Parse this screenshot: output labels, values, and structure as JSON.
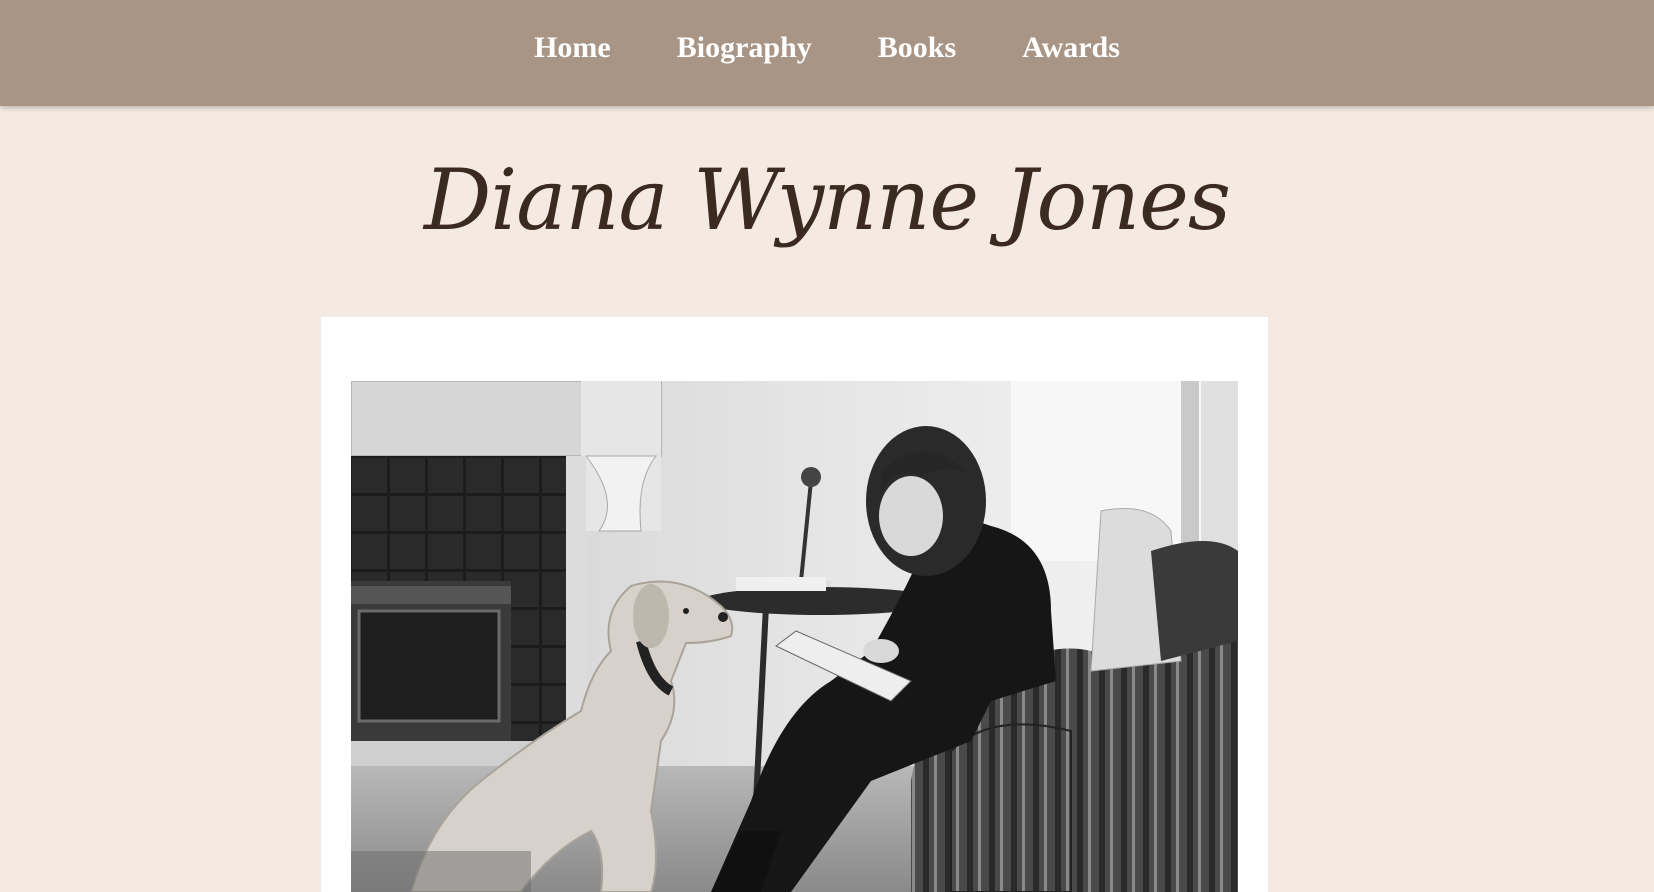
{
  "nav": {
    "items": [
      {
        "label": "Home"
      },
      {
        "label": "Biography"
      },
      {
        "label": "Books"
      },
      {
        "label": "Awards"
      }
    ]
  },
  "header": {
    "title": "Diana Wynne Jones"
  },
  "photo": {
    "alt": "Diana Wynne Jones seated in an armchair writing in a notebook, with a dog sitting in front of her by a fireplace"
  },
  "colors": {
    "nav_background": "#a89585",
    "page_background": "#f5eae1",
    "title_color": "#3a2a1f",
    "card_background": "#ffffff"
  }
}
